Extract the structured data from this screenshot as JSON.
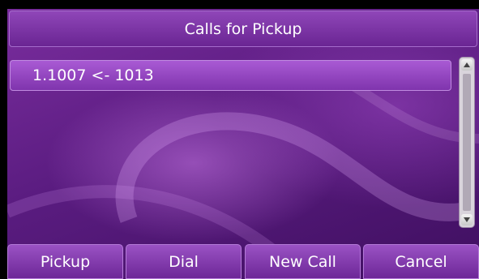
{
  "title": "Calls for Pickup",
  "list": {
    "items": [
      {
        "label": "1.1007 <- 1013"
      }
    ]
  },
  "softkeys": [
    {
      "label": "Pickup"
    },
    {
      "label": "Dial"
    },
    {
      "label": "New Call"
    },
    {
      "label": "Cancel"
    }
  ]
}
